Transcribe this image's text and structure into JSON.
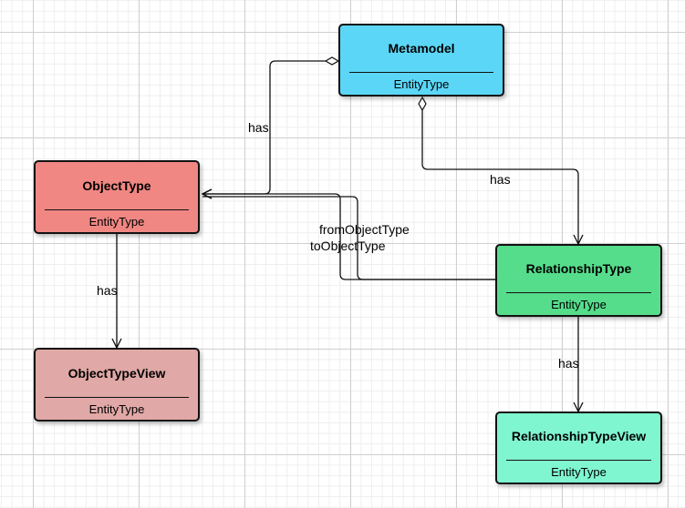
{
  "nodes": {
    "metamodel": {
      "name": "Metamodel",
      "stereotype": "EntityType",
      "color": "#5bd6f7"
    },
    "object_type": {
      "name": "ObjectType",
      "stereotype": "EntityType",
      "color": "#f08783"
    },
    "object_type_view": {
      "name": "ObjectTypeView",
      "stereotype": "EntityType",
      "color": "#e0a8a6"
    },
    "relationship_type": {
      "name": "RelationshipType",
      "stereotype": "EntityType",
      "color": "#55dd8b"
    },
    "relationship_type_view": {
      "name": "RelationshipTypeView",
      "stereotype": "EntityType",
      "color": "#7ff5d0"
    }
  },
  "edge_labels": {
    "metamodel_has_objecttype": "has",
    "metamodel_has_relationshiptype": "has",
    "objecttype_has_view": "has",
    "relationshiptype_has_view": "has",
    "from_object_type": "fromObjectType",
    "to_object_type": "toObjectType"
  }
}
